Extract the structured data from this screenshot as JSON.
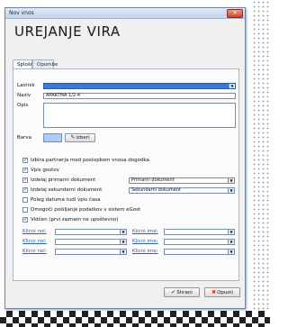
{
  "window": {
    "title": "Nov vnos",
    "close_symbol": "×"
  },
  "heading": "UREJANJE VIRA",
  "tabs": [
    {
      "label": "Splošno",
      "active": true
    },
    {
      "label": "Opombe",
      "active": false
    }
  ],
  "form": {
    "lastnik_label": "Lastnik",
    "naziv_label": "Naziv",
    "naziv_value": "APARTMA 1/2-4",
    "opis_label": "Opis",
    "barva_label": "Barva",
    "izberi_label": "Izberi",
    "barva_color": "#a9cdf5"
  },
  "checkboxes": [
    {
      "label": "Izbira partnerja med postopkom vnosa dogodka",
      "checked": true
    },
    {
      "label": "Vpis gostov",
      "checked": true
    },
    {
      "label": "Izdelaj primarni dokument",
      "checked": true,
      "select": "Primarni dokument"
    },
    {
      "label": "Izdelaj sekundarni dokument",
      "checked": true,
      "select": "Sekundarni dokument"
    },
    {
      "label": "Poleg datuma tudi vpis časa",
      "checked": false
    },
    {
      "label": "Omogoči pošiljanje podatkov v sistem eGost",
      "checked": false
    },
    {
      "label": "Vidčen (prvi zaznam ne upoštevno)",
      "checked": true
    }
  ],
  "klici": [
    {
      "left": "Klicni nol:",
      "right": "Klicni ime:"
    },
    {
      "left": "Klicni nol:",
      "right": "Klicni ime:"
    },
    {
      "left": "Klicni nol:",
      "right": "Klicni ime:"
    }
  ],
  "buttons": {
    "ok_label": "Shrani",
    "ok_icon": "✔",
    "cancel_label": "Opusti",
    "cancel_icon": "✖",
    "pick_icon": "✎"
  },
  "colors": {
    "accent": "#3e79d6",
    "link": "#2a5fc1",
    "ok": "#2e9a2e",
    "cancel": "#c9302c"
  }
}
